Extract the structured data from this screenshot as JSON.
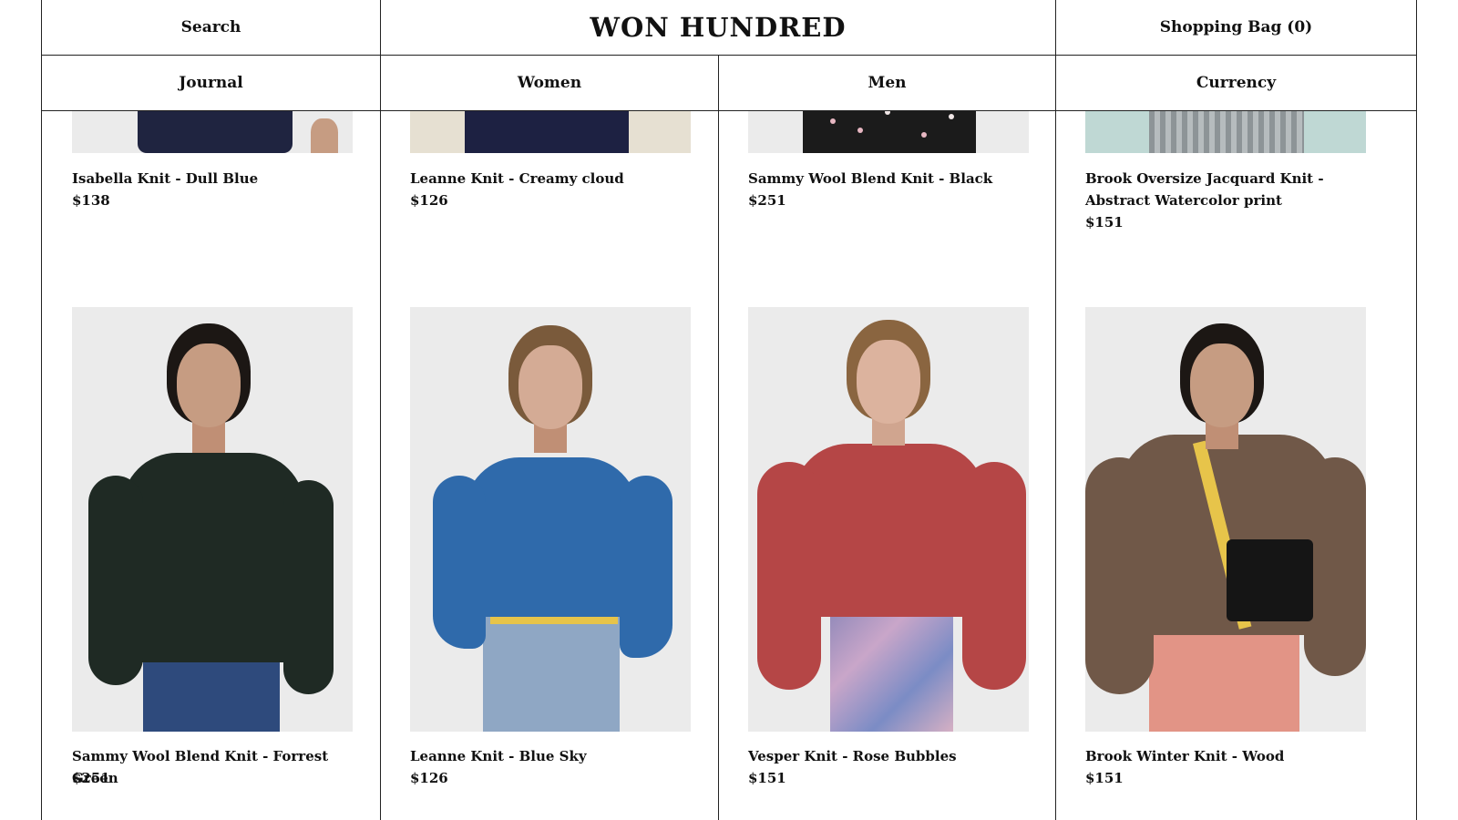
{
  "header": {
    "search_label": "Search",
    "brand": "WON HUNDRED",
    "bag_label": "Shopping Bag (0)"
  },
  "nav": {
    "journal": "Journal",
    "women": "Women",
    "men": "Men",
    "currency": "Currency"
  },
  "products_top": [
    {
      "name": "Isabella Knit - Dull Blue",
      "price": "$138",
      "colors": {
        "garment": "#1f2440"
      }
    },
    {
      "name": "Leanne Knit - Creamy cloud",
      "price": "$126",
      "colors": {
        "garment": "#1d2142"
      }
    },
    {
      "name": "Sammy Wool Blend Knit - Black",
      "price": "$251",
      "colors": {
        "garment": "#1b1b1b"
      }
    },
    {
      "name": "Brook Oversize Jacquard Knit - Abstract Watercolor print",
      "price": "$151",
      "colors": {
        "garment": "#8d9497"
      }
    }
  ],
  "products_bottom": [
    {
      "name": "Sammy Wool Blend Knit - Forrest Green",
      "price": "$251",
      "colors": {
        "garment": "#1f2a24",
        "legs": "#2e4a7c",
        "hair": "#1c1714"
      }
    },
    {
      "name": "Leanne Knit - Blue Sky",
      "price": "$126",
      "colors": {
        "garment": "#2f6aab",
        "legs": "#8fa7c4",
        "hair": "#7a5a3b"
      }
    },
    {
      "name": "Vesper Knit - Rose Bubbles",
      "price": "$151",
      "colors": {
        "garment": "#b54646",
        "legs": "#8f88b9",
        "hair": "#8a6540"
      }
    },
    {
      "name": "Brook Winter Knit - Wood",
      "price": "$151",
      "colors": {
        "garment": "#705848",
        "legs": "#e29486",
        "hair": "#1c1714"
      }
    }
  ]
}
